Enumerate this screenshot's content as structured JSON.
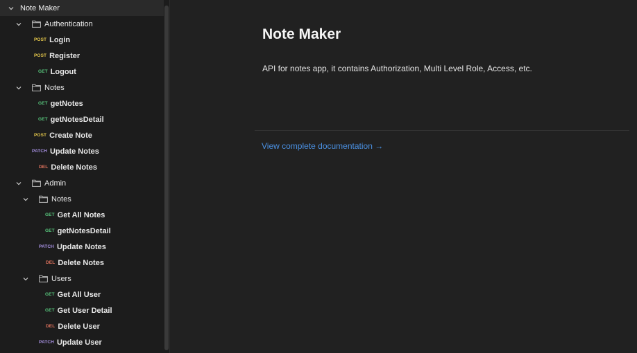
{
  "sidebar": {
    "root": {
      "label": "Note Maker"
    },
    "auth": {
      "label": "Authentication",
      "items": [
        {
          "method": "POST",
          "label": "Login"
        },
        {
          "method": "POST",
          "label": "Register"
        },
        {
          "method": "GET",
          "label": "Logout"
        }
      ]
    },
    "notes": {
      "label": "Notes",
      "items": [
        {
          "method": "GET",
          "label": "getNotes"
        },
        {
          "method": "GET",
          "label": "getNotesDetail"
        },
        {
          "method": "POST",
          "label": "Create Note"
        },
        {
          "method": "PATCH",
          "label": "Update Notes"
        },
        {
          "method": "DEL",
          "label": "Delete Notes"
        }
      ]
    },
    "admin": {
      "label": "Admin",
      "notes": {
        "label": "Notes",
        "items": [
          {
            "method": "GET",
            "label": "Get All Notes"
          },
          {
            "method": "GET",
            "label": "getNotesDetail"
          },
          {
            "method": "PATCH",
            "label": "Update Notes"
          },
          {
            "method": "DEL",
            "label": "Delete Notes"
          }
        ]
      },
      "users": {
        "label": "Users",
        "items": [
          {
            "method": "GET",
            "label": "Get All User"
          },
          {
            "method": "GET",
            "label": "Get User Detail"
          },
          {
            "method": "DEL",
            "label": "Delete User"
          },
          {
            "method": "PATCH",
            "label": "Update User"
          }
        ]
      }
    }
  },
  "main": {
    "title": "Note Maker",
    "description": "API for notes app, it contains Authorization, Multi Level Role, Access, etc.",
    "doc_link": "View complete documentation →"
  },
  "colors": {
    "post": "#e5c84b",
    "get": "#56c27a",
    "patch": "#a58fe0",
    "del": "#e2735e",
    "link": "#4a90e2"
  }
}
